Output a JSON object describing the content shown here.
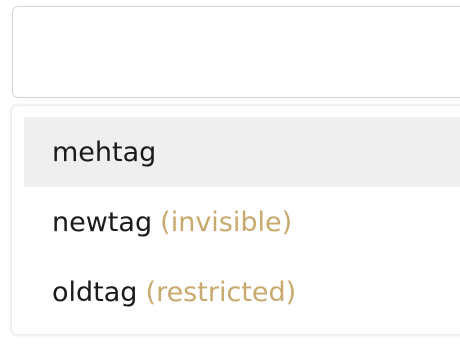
{
  "tag_input": {
    "value": ""
  },
  "suggestions": [
    {
      "name": "mehtag",
      "note": "",
      "highlighted": true
    },
    {
      "name": "newtag",
      "note": "(invisible)",
      "highlighted": false
    },
    {
      "name": "oldtag",
      "note": "(restricted)",
      "highlighted": false
    }
  ],
  "colors": {
    "highlight_background": "#efefef",
    "note_text": "#c9a96e",
    "main_text": "#1a1a1a",
    "border": "#d4d4d4"
  }
}
